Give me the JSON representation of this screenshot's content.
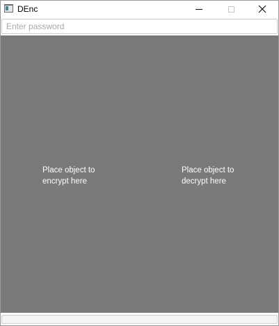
{
  "window": {
    "title": "DEnc"
  },
  "titlebar": {
    "controls": [
      "minimize-icon",
      "maximize-icon",
      "close-icon"
    ]
  },
  "password": {
    "placeholder": "Enter password",
    "value": ""
  },
  "drop_area": {
    "background_color": "#7a7a7a",
    "encrypt_label": "Place object to\nencrypt here",
    "decrypt_label": "Place object to\ndecrypt here"
  }
}
